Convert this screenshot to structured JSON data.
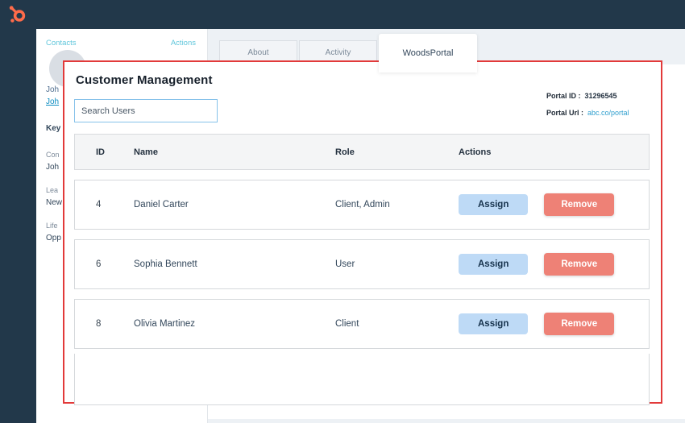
{
  "topbar": {
    "logo_icon": "hubspot-sprocket-icon"
  },
  "sidebar": {
    "contacts_label": "Contacts",
    "actions_label": "Actions",
    "lines": [
      {
        "text": "Joh",
        "role": "contact-name-truncated"
      },
      {
        "text": "Joh",
        "role": "contact-link-truncated"
      },
      {
        "text": "Key",
        "role": "section-heading-truncated"
      },
      {
        "text": "Con",
        "role": "field-label-truncated"
      },
      {
        "text": "Joh",
        "role": "field-value-truncated"
      },
      {
        "text": "Lea",
        "role": "field-label-truncated"
      },
      {
        "text": "New",
        "role": "field-value-truncated"
      },
      {
        "text": "Life",
        "role": "field-label-truncated"
      },
      {
        "text": "Opp",
        "role": "field-value-truncated"
      }
    ]
  },
  "tabs": [
    {
      "label": "About",
      "active": false
    },
    {
      "label": "Activity",
      "active": false
    },
    {
      "label": "WoodsPortal",
      "active": true
    }
  ],
  "modal": {
    "title": "Customer Management",
    "search_placeholder": "Search Users",
    "portal_id_label": "Portal ID :",
    "portal_id_value": "31296545",
    "portal_url_label": "Portal Url :",
    "portal_url_value": "abc.co/portal",
    "table": {
      "headers": [
        "ID",
        "Name",
        "Role",
        "Actions"
      ],
      "rows": [
        {
          "id": "4",
          "name": "Daniel Carter",
          "role": "Client, Admin"
        },
        {
          "id": "6",
          "name": "Sophia Bennett",
          "role": "User"
        },
        {
          "id": "8",
          "name": "Olivia Martinez",
          "role": "Client"
        }
      ],
      "assign_label": "Assign",
      "remove_label": "Remove"
    }
  },
  "colors": {
    "topbar_bg": "#22384a",
    "logo_orange": "#ff6b4a",
    "modal_border_red": "#e23a3a",
    "assign_button_bg": "#bedaf6",
    "remove_button_bg": "#ee8176",
    "sidebar_cyan": "#5fc6db",
    "link_blue": "#2f9fce",
    "page_bg": "#edf1f5"
  }
}
